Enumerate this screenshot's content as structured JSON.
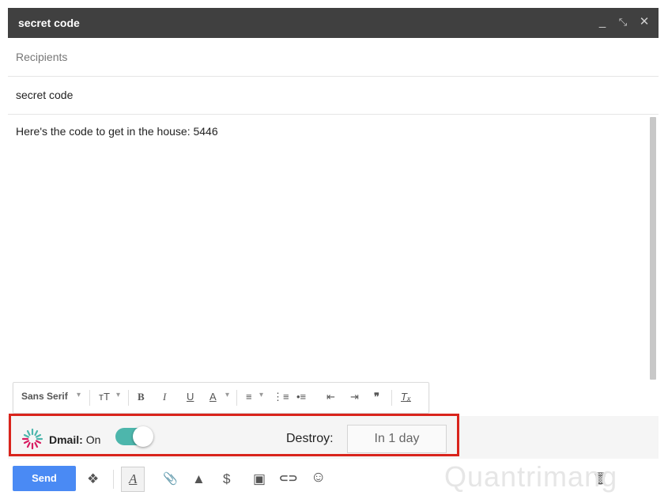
{
  "window": {
    "title": "secret code",
    "controls": {
      "minimize": "_",
      "expand": "⤡",
      "close": "✕"
    }
  },
  "recipients": {
    "placeholder": "Recipients"
  },
  "subject": {
    "value": "secret code"
  },
  "body": {
    "text": "Here's the code to get in the house: 5446"
  },
  "formatting": {
    "font": "Sans Serif",
    "font_arrow": "▾",
    "size_icon": "тT",
    "size_arrow": "▾",
    "bold": "B",
    "italic": "I",
    "underline": "U",
    "text_color": "A",
    "color_arrow": "▾",
    "align": "≡",
    "align_arrow": "▾",
    "numbered_list": "⋮≡",
    "bulleted_list": "•≡",
    "indent_less": "⇤",
    "indent_more": "⇥",
    "quote": "❞",
    "remove_format": "Tₓ"
  },
  "dmail": {
    "label": "Dmail:",
    "status": "On",
    "toggle_on": true,
    "destroy_label": "Destroy:",
    "destroy_value": "In 1 day",
    "accent_color": "#4db6ac"
  },
  "bottom_toolbar": {
    "send": "Send",
    "dropbox": "❖",
    "format": "A",
    "attach": "📎",
    "drive": "▲",
    "money": "$",
    "photo": "▣",
    "link": "⊂⊃",
    "emoji": "☺",
    "trash": "🗑"
  },
  "watermark": "Quantrimang"
}
